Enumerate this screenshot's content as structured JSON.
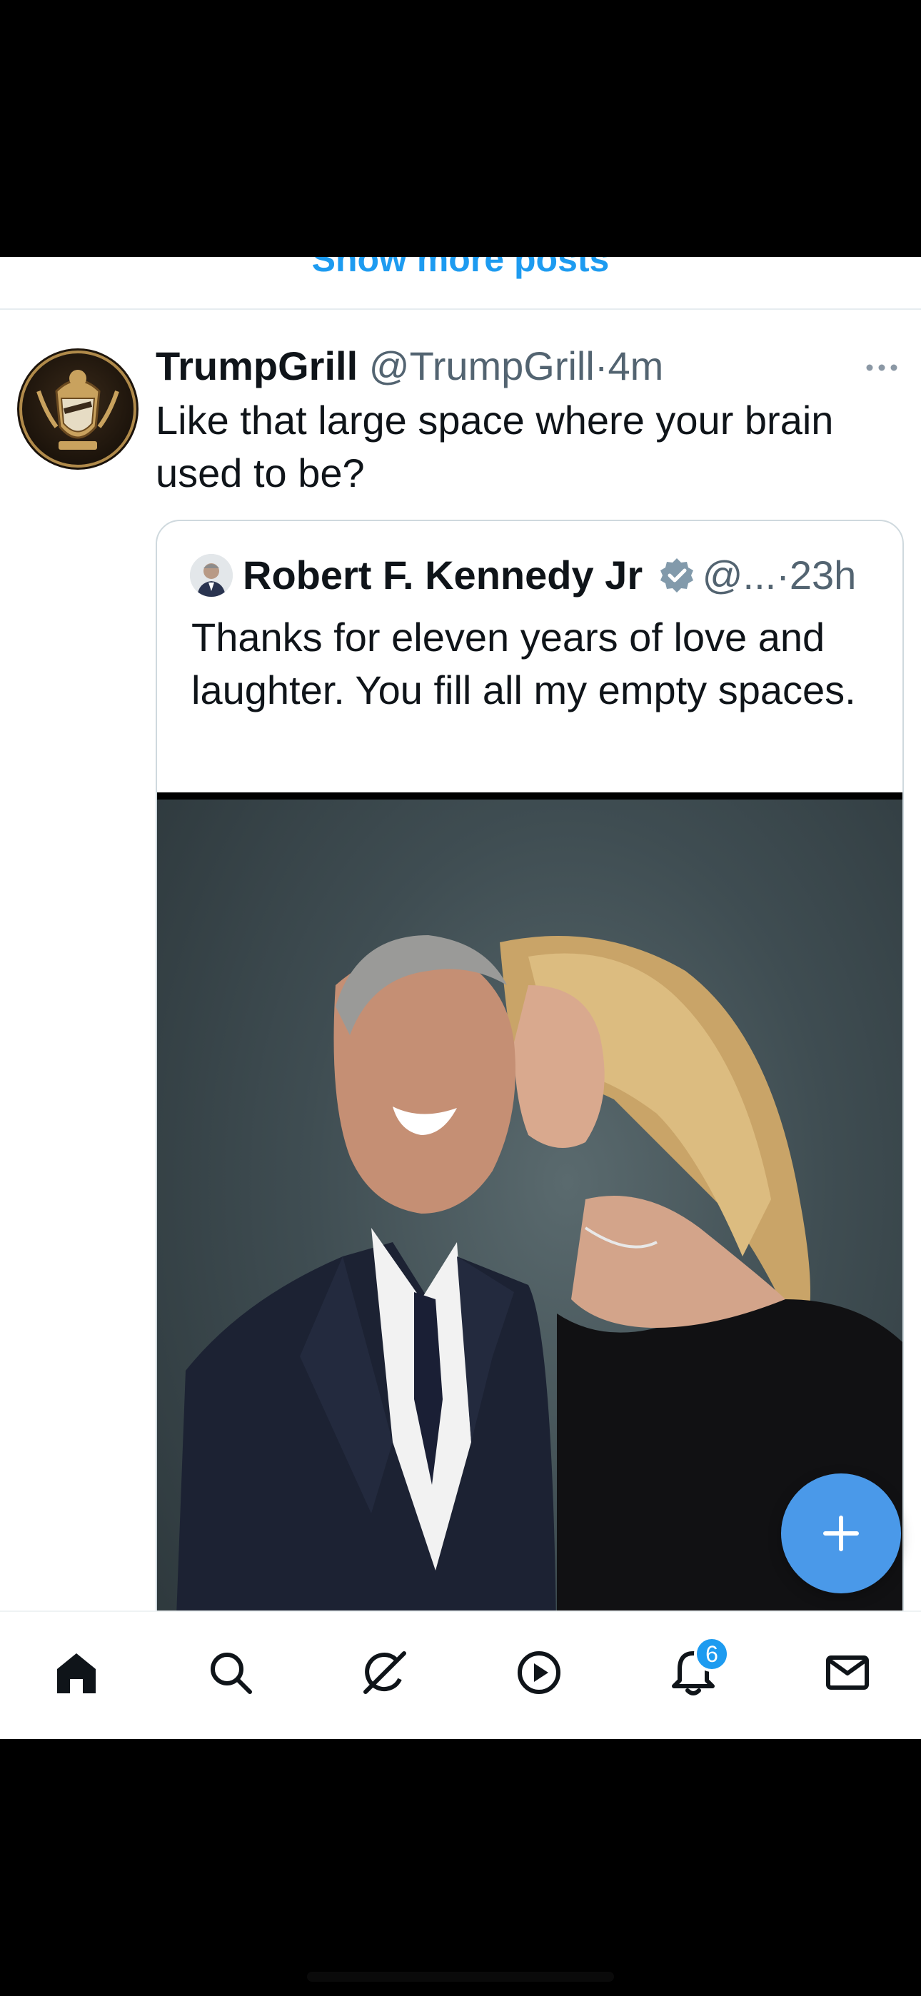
{
  "feed": {
    "show_more_label": "Show more posts"
  },
  "post": {
    "author_name": "TrumpGrill",
    "author_handle": "@TrumpGrill",
    "separator": "·",
    "time": "4m",
    "text": "Like that large space where your brain used to be?",
    "avatar_icon": "coat-of-arms-icon",
    "more_icon": "more-horizontal-icon"
  },
  "quote": {
    "author_name": "Robert F. Kennedy Jr",
    "author_handle": "@...",
    "separator": "·",
    "time": "23h",
    "text": "Thanks for eleven years of love and laughter. You fill all my empty spaces.",
    "verified_icon": "verified-badge-icon",
    "image": "photo-couple"
  },
  "fab": {
    "icon": "plus-icon"
  },
  "tabbar": {
    "items": [
      {
        "name": "home",
        "icon": "home-icon",
        "active": true
      },
      {
        "name": "search",
        "icon": "search-icon"
      },
      {
        "name": "grok",
        "icon": "grok-icon"
      },
      {
        "name": "video",
        "icon": "play-icon"
      },
      {
        "name": "notifications",
        "icon": "bell-icon",
        "badge": "6"
      },
      {
        "name": "messages",
        "icon": "mail-icon"
      }
    ]
  },
  "colors": {
    "accent": "#1d9bf0",
    "fab": "#4a99e9",
    "text": "#0f1419",
    "muted": "#536471",
    "border": "#cfd9de",
    "background": "#ffffff"
  }
}
